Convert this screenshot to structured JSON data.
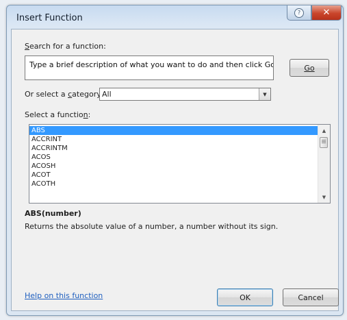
{
  "window": {
    "title": "Insert Function"
  },
  "search": {
    "label": "Search for a function:",
    "label_accesskey": "S",
    "label_rest": "earch for a function:",
    "value": "Type a brief description of what you want to do and then click Go",
    "go_label": "Go"
  },
  "category": {
    "label_pre": "Or select a ",
    "label_accesskey": "c",
    "label_post": "ategory:",
    "value": "All"
  },
  "function_list": {
    "label_pre": "Select a functio",
    "label_accesskey": "n",
    "label_post": ":",
    "items": [
      "ABS",
      "ACCRINT",
      "ACCRINTM",
      "ACOS",
      "ACOSH",
      "ACOT",
      "ACOTH"
    ],
    "selected": "ABS"
  },
  "description": {
    "signature": "ABS(number)",
    "text": "Returns the absolute value of a number, a number without its sign."
  },
  "footer": {
    "help_link": "Help on this function",
    "ok_label": "OK",
    "cancel_label": "Cancel"
  },
  "colors": {
    "selection": "#3399ff",
    "link": "#1f5fbf",
    "close": "#c9452b"
  },
  "icons": {
    "help": "help-icon",
    "close": "close-icon",
    "dropdown": "chevron-down-icon"
  }
}
